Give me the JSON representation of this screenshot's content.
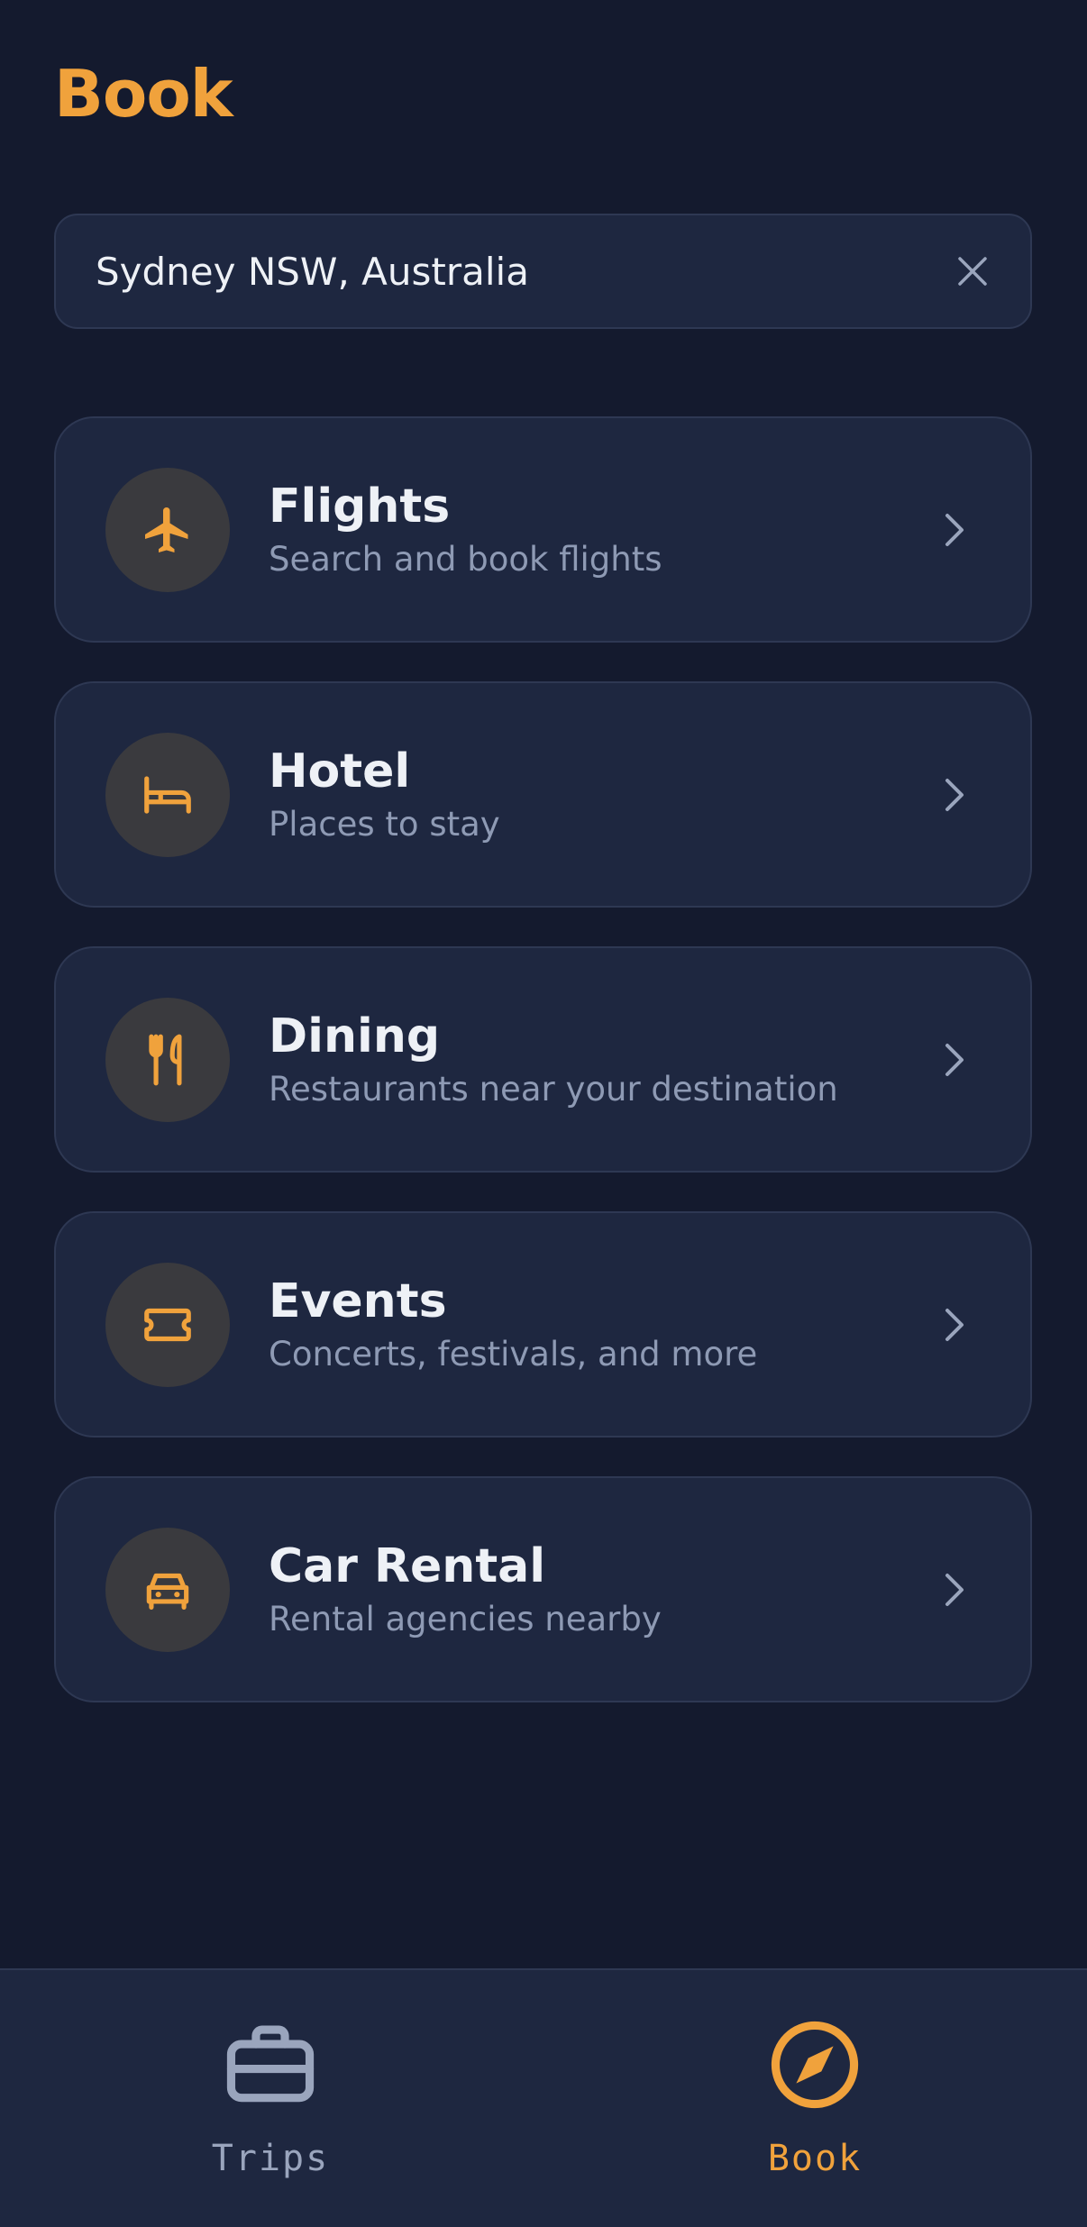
{
  "header": {
    "title": "Book"
  },
  "search": {
    "value": "Sydney NSW, Australia",
    "placeholder": ""
  },
  "categories": [
    {
      "title": "Flights",
      "subtitle": "Search and book flights",
      "icon": "airplane-icon"
    },
    {
      "title": "Hotel",
      "subtitle": "Places to stay",
      "icon": "bed-icon"
    },
    {
      "title": "Dining",
      "subtitle": "Restaurants near your destination",
      "icon": "fork-knife-icon"
    },
    {
      "title": "Events",
      "subtitle": "Concerts, festivals, and more",
      "icon": "ticket-icon"
    },
    {
      "title": "Car Rental",
      "subtitle": "Rental agencies nearby",
      "icon": "car-icon"
    }
  ],
  "nav": [
    {
      "label": "Trips",
      "icon": "briefcase-icon",
      "active": false
    },
    {
      "label": "Book",
      "icon": "compass-icon",
      "active": true
    }
  ],
  "colors": {
    "accent": "#f0a23c",
    "background": "#141a2e",
    "card": "#1e2740",
    "muted": "#8e9ab4"
  }
}
